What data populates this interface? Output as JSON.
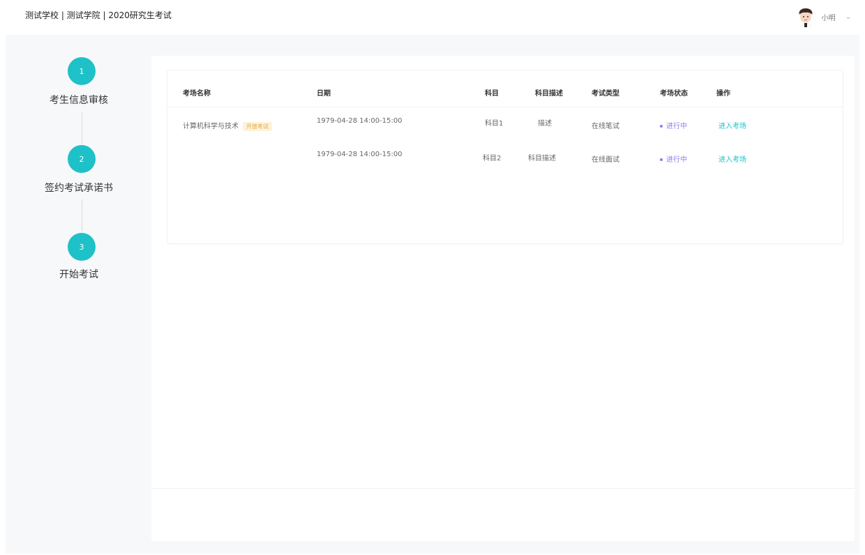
{
  "header": {
    "title": "测试学校 | 测试学院 | 2020研究生考试",
    "username": "小明",
    "avatar_icon": "user-avatar",
    "dropdown_icon": "chevron-down-icon"
  },
  "steps": [
    {
      "number": "1",
      "label": "考生信息审核"
    },
    {
      "number": "2",
      "label": "签约考试承诺书"
    },
    {
      "number": "3",
      "label": "开始考试"
    }
  ],
  "table": {
    "columns": [
      "考场名称",
      "日期",
      "科目",
      "科目描述",
      "考试类型",
      "考场状态",
      "操作"
    ],
    "rows": [
      {
        "name": "计算机科学与技术",
        "tag": "开放考试",
        "date": "1979-04-28 14:00-15:00",
        "subject": "科目1",
        "description": "描述",
        "type": "在线笔试",
        "status": "进行中",
        "action": "进入考场"
      },
      {
        "name": "",
        "tag": "",
        "date": "1979-04-28 14:00-15:00",
        "subject": "科目2",
        "description": "科目描述",
        "type": "在线面试",
        "status": "进行中",
        "action": "进入考场"
      }
    ]
  },
  "colors": {
    "accent": "#1fc1c8",
    "status": "#8a7df3",
    "tag_bg": "#fdf3dd",
    "tag_text": "#e8a93b"
  }
}
